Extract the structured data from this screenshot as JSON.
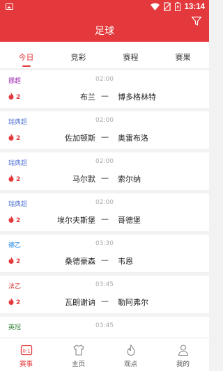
{
  "status_bar": {
    "time": "13:14",
    "colors": {
      "bar": "#e4393c"
    }
  },
  "header": {
    "title": "足球",
    "filter_icon": "filter-icon"
  },
  "tabs": [
    {
      "label": "今日",
      "active": true
    },
    {
      "label": "竞彩",
      "active": false
    },
    {
      "label": "赛程",
      "active": false
    },
    {
      "label": "赛果",
      "active": false
    }
  ],
  "matches": [
    {
      "league": "挪超",
      "league_color": "#9c27b0",
      "time": "02:00",
      "heat": "2",
      "home": "布兰",
      "vs": "—",
      "away": "博多格林特"
    },
    {
      "league": "瑞典超",
      "league_color": "#5b7bd5",
      "time": "02:00",
      "heat": "2",
      "home": "佐加顿斯",
      "vs": "—",
      "away": "奥雷布洛"
    },
    {
      "league": "瑞典超",
      "league_color": "#5b7bd5",
      "time": "02:00",
      "heat": "2",
      "home": "马尔默",
      "vs": "—",
      "away": "索尔纳"
    },
    {
      "league": "瑞典超",
      "league_color": "#5b7bd5",
      "time": "02:00",
      "heat": "2",
      "home": "埃尔夫斯堡",
      "vs": "—",
      "away": "哥德堡"
    },
    {
      "league": "德乙",
      "league_color": "#1e88e5",
      "time": "03:30",
      "heat": "2",
      "home": "桑德豪森",
      "vs": "—",
      "away": "韦恩"
    },
    {
      "league": "法乙",
      "league_color": "#d32f2f",
      "time": "03:45",
      "heat": "2",
      "home": "瓦朗谢讷",
      "vs": "—",
      "away": "勒阿弗尔"
    },
    {
      "league": "英冠",
      "league_color": "#2e7d32",
      "time": "03:45",
      "heat": "",
      "home": "",
      "vs": "",
      "away": ""
    }
  ],
  "bottom_nav": [
    {
      "label": "赛事",
      "icon": "scoreboard-icon",
      "active": true
    },
    {
      "label": "主页",
      "icon": "shirt-icon",
      "active": false
    },
    {
      "label": "观点",
      "icon": "flame-icon",
      "active": false
    },
    {
      "label": "我的",
      "icon": "person-icon",
      "active": false
    }
  ],
  "colors": {
    "accent": "#e4393c"
  }
}
